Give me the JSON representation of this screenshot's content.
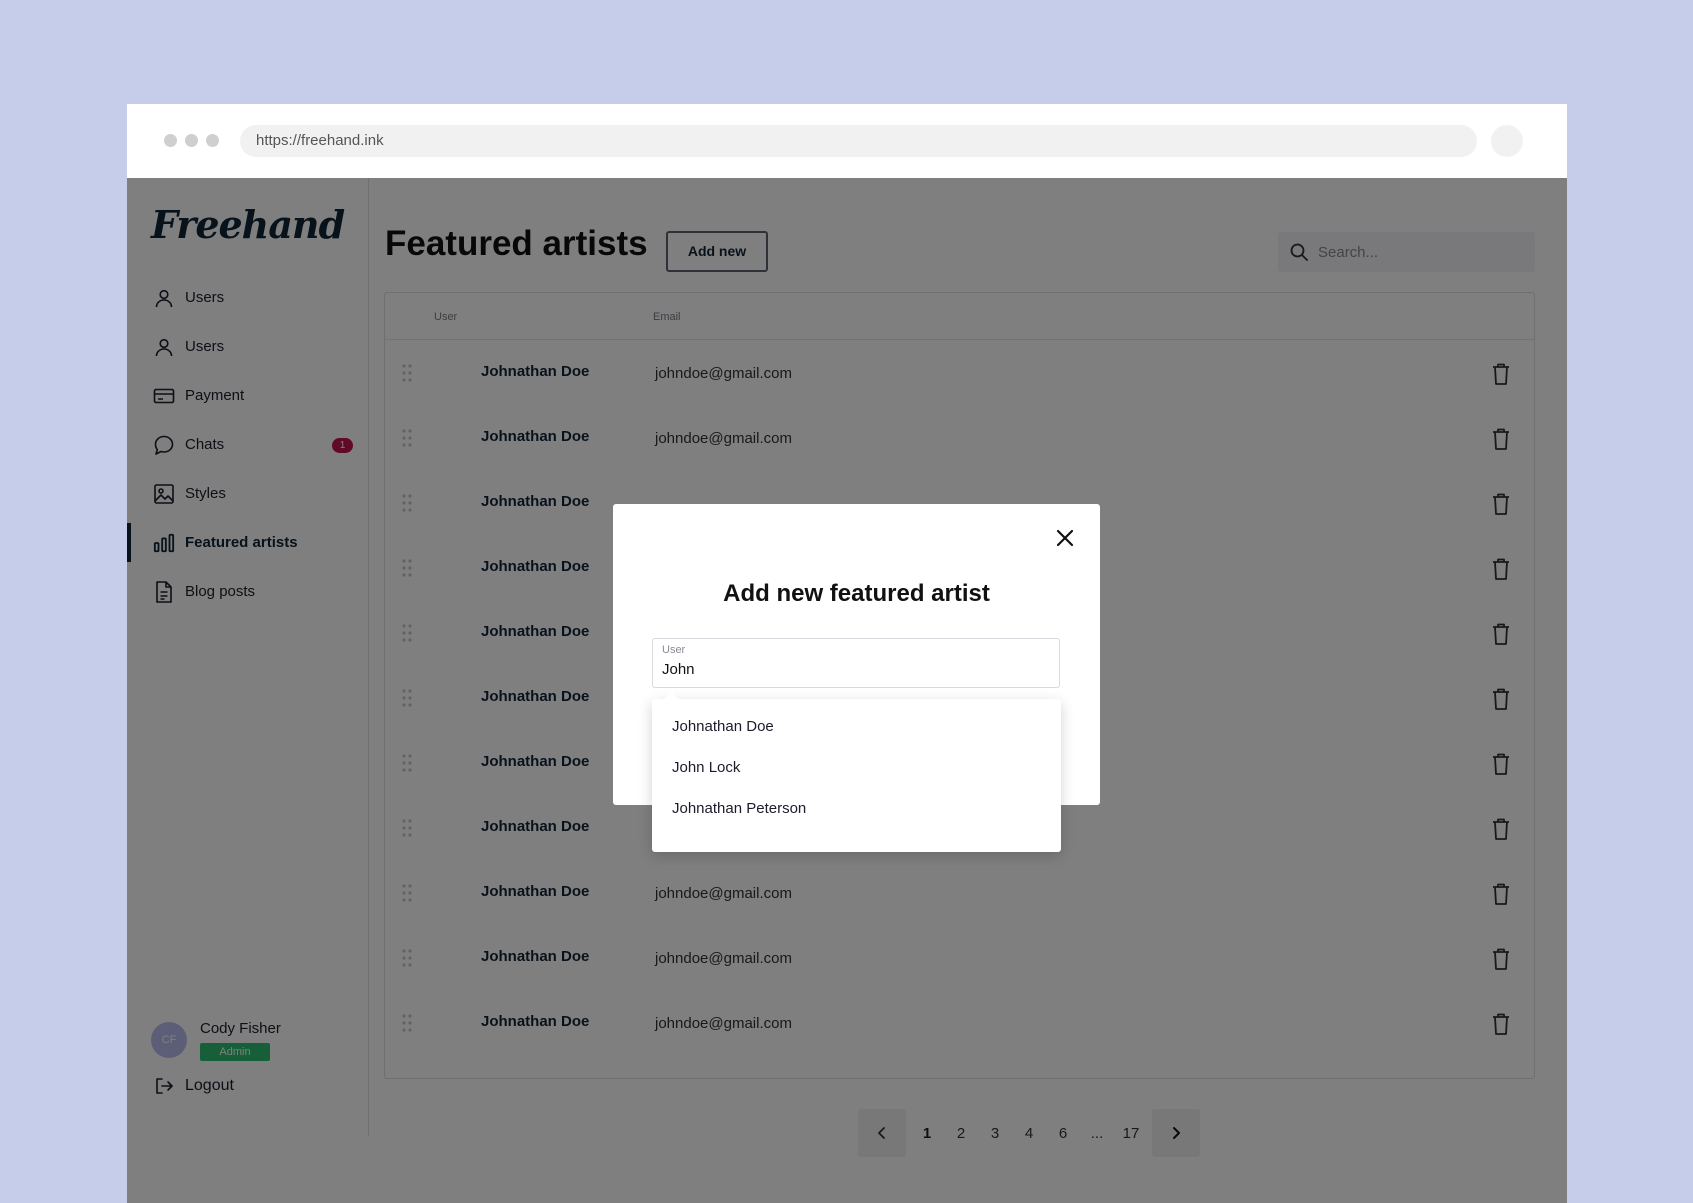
{
  "browser": {
    "url": "https://freehand.ink"
  },
  "brand": {
    "logo_text": "Freehand",
    "primary_color": "#102436",
    "badge_color": "#c0144f",
    "role_color": "#2fbf71",
    "background_color": "#c5cdea"
  },
  "sidebar": {
    "items": [
      {
        "label": "Users",
        "icon": "user-icon"
      },
      {
        "label": "Users",
        "icon": "user-icon"
      },
      {
        "label": "Payment",
        "icon": "credit-card-icon"
      },
      {
        "label": "Chats",
        "icon": "chat-bubble-icon",
        "badge": "1"
      },
      {
        "label": "Styles",
        "icon": "image-icon"
      },
      {
        "label": "Featured artists",
        "icon": "bar-chart-icon",
        "active": true
      },
      {
        "label": "Blog posts",
        "icon": "document-icon"
      }
    ],
    "user": {
      "initials": "CF",
      "name": "Cody Fisher",
      "role": "Admin"
    },
    "logout_label": "Logout"
  },
  "header": {
    "title": "Featured artists",
    "add_button": "Add new",
    "search_placeholder": "Search..."
  },
  "table": {
    "columns": [
      "User",
      "Email"
    ],
    "rows": [
      {
        "user": "Johnathan Doe",
        "email": "johndoe@gmail.com"
      },
      {
        "user": "Johnathan Doe",
        "email": "johndoe@gmail.com"
      },
      {
        "user": "Johnathan Doe",
        "email": ""
      },
      {
        "user": "Johnathan Doe",
        "email": ""
      },
      {
        "user": "Johnathan Doe",
        "email": ""
      },
      {
        "user": "Johnathan Doe",
        "email": ""
      },
      {
        "user": "Johnathan Doe",
        "email": ""
      },
      {
        "user": "Johnathan Doe",
        "email": ""
      },
      {
        "user": "Johnathan Doe",
        "email": "johndoe@gmail.com"
      },
      {
        "user": "Johnathan Doe",
        "email": "johndoe@gmail.com"
      },
      {
        "user": "Johnathan Doe",
        "email": "johndoe@gmail.com"
      }
    ]
  },
  "pagination": {
    "pages": [
      "1",
      "2",
      "3",
      "4",
      "6",
      "...",
      "17"
    ],
    "current": "1"
  },
  "modal": {
    "title": "Add new featured artist",
    "field_label": "User",
    "field_value": "John",
    "suggestions": [
      "Johnathan Doe",
      "John Lock",
      "Johnathan Peterson"
    ]
  }
}
